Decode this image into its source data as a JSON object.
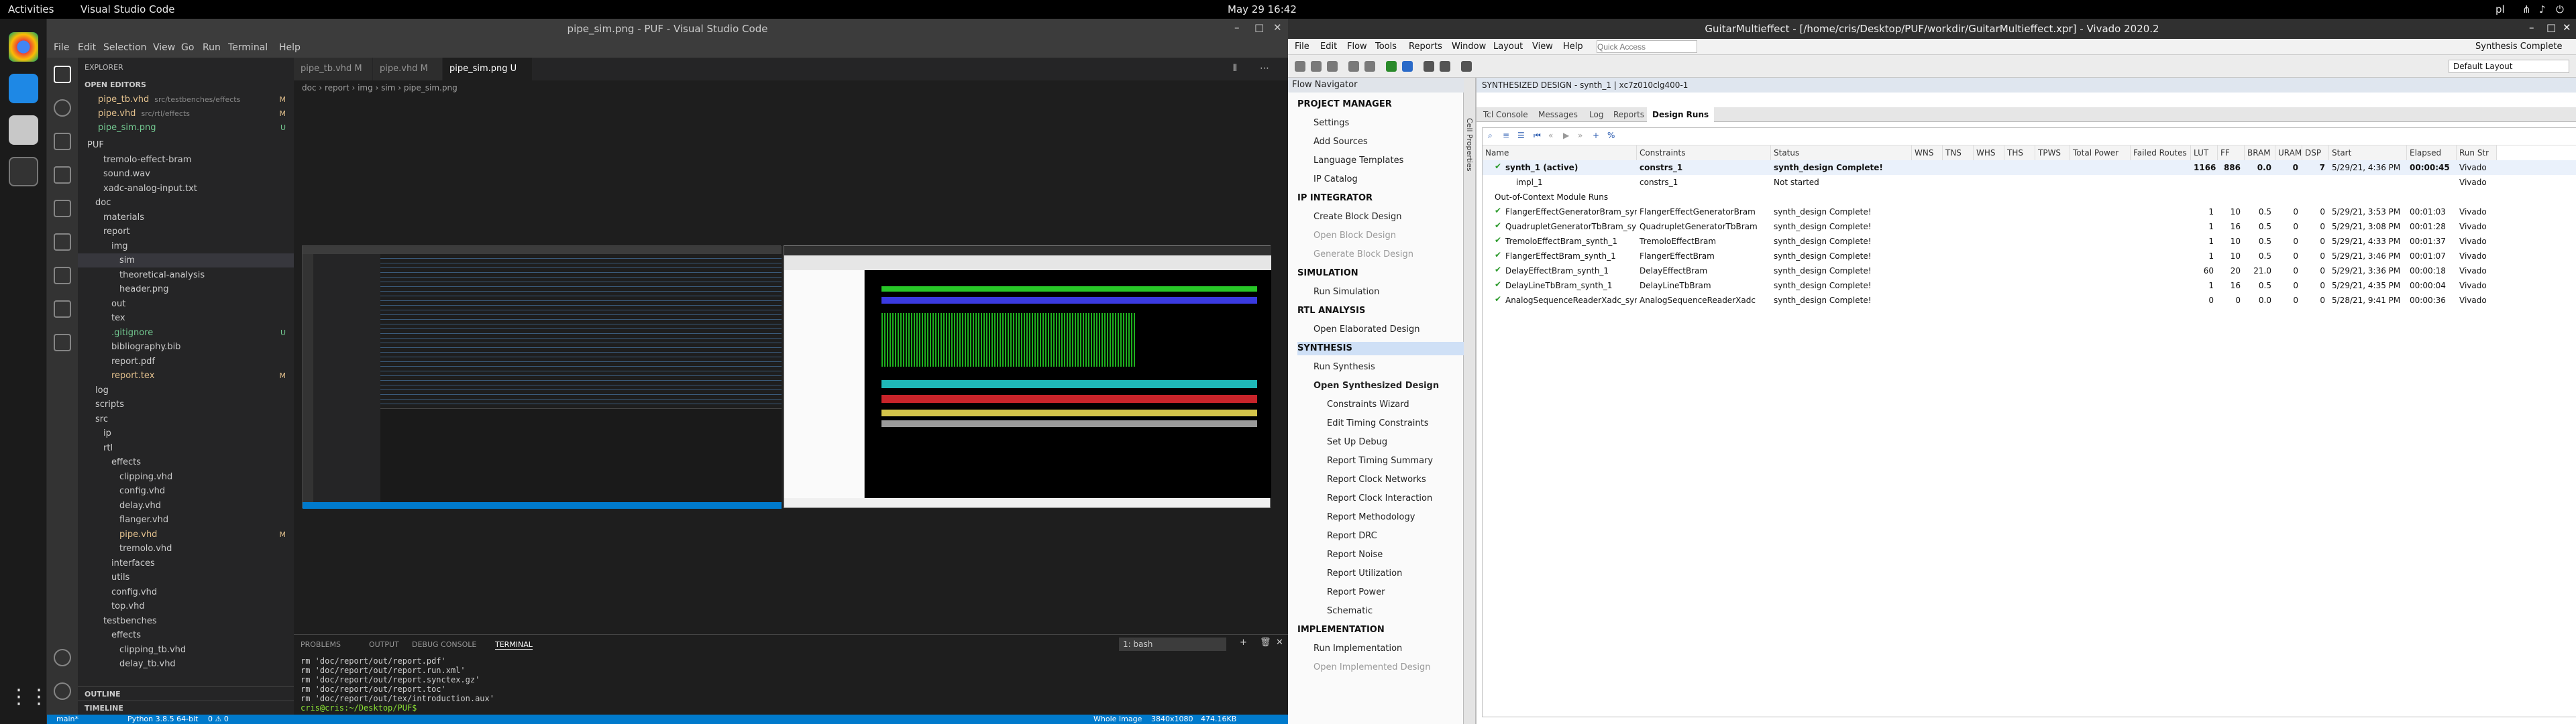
{
  "topbar": {
    "activities": "Activities",
    "app": "Visual Studio Code",
    "clock": "May 29  16:42",
    "lang": "pl"
  },
  "vscode": {
    "title": "pipe_sim.png - PUF - Visual Studio Code",
    "menu": [
      "File",
      "Edit",
      "Selection",
      "View",
      "Go",
      "Run",
      "Terminal",
      "Help"
    ],
    "explorer_title": "EXPLORER",
    "open_editors_label": "OPEN EDITORS",
    "open_editors": [
      {
        "name": "pipe_tb.vhd",
        "path": "src/testbenches/effects",
        "badge": "M"
      },
      {
        "name": "pipe.vhd",
        "path": "src/rtl/effects",
        "badge": "M"
      },
      {
        "name": "pipe_sim.png",
        "path": "",
        "badge": "U"
      }
    ],
    "tree": [
      {
        "label": "PUF",
        "indent": 0,
        "badge": ""
      },
      {
        "label": "tremolo-effect-bram",
        "indent": 2,
        "badge": ""
      },
      {
        "label": "sound.wav",
        "indent": 2,
        "badge": ""
      },
      {
        "label": "xadc-analog-input.txt",
        "indent": 2,
        "badge": ""
      },
      {
        "label": "doc",
        "indent": 1,
        "badge": ""
      },
      {
        "label": "materials",
        "indent": 2,
        "badge": ""
      },
      {
        "label": "report",
        "indent": 2,
        "badge": ""
      },
      {
        "label": "img",
        "indent": 3,
        "badge": ""
      },
      {
        "label": "sim",
        "indent": 4,
        "badge": ""
      },
      {
        "label": "theoretical-analysis",
        "indent": 4,
        "badge": ""
      },
      {
        "label": "header.png",
        "indent": 4,
        "badge": ""
      },
      {
        "label": "out",
        "indent": 3,
        "badge": ""
      },
      {
        "label": "tex",
        "indent": 3,
        "badge": ""
      },
      {
        "label": ".gitignore",
        "indent": 3,
        "badge": "U"
      },
      {
        "label": "bibliography.bib",
        "indent": 3,
        "badge": ""
      },
      {
        "label": "report.pdf",
        "indent": 3,
        "badge": ""
      },
      {
        "label": "report.tex",
        "indent": 3,
        "badge": "M"
      },
      {
        "label": "log",
        "indent": 1,
        "badge": ""
      },
      {
        "label": "scripts",
        "indent": 1,
        "badge": ""
      },
      {
        "label": "src",
        "indent": 1,
        "badge": ""
      },
      {
        "label": "ip",
        "indent": 2,
        "badge": ""
      },
      {
        "label": "rtl",
        "indent": 2,
        "badge": ""
      },
      {
        "label": "effects",
        "indent": 3,
        "badge": ""
      },
      {
        "label": "clipping.vhd",
        "indent": 4,
        "badge": ""
      },
      {
        "label": "config.vhd",
        "indent": 4,
        "badge": ""
      },
      {
        "label": "delay.vhd",
        "indent": 4,
        "badge": ""
      },
      {
        "label": "flanger.vhd",
        "indent": 4,
        "badge": ""
      },
      {
        "label": "pipe.vhd",
        "indent": 4,
        "badge": "M"
      },
      {
        "label": "tremolo.vhd",
        "indent": 4,
        "badge": ""
      },
      {
        "label": "interfaces",
        "indent": 3,
        "badge": ""
      },
      {
        "label": "utils",
        "indent": 3,
        "badge": ""
      },
      {
        "label": "config.vhd",
        "indent": 3,
        "badge": ""
      },
      {
        "label": "top.vhd",
        "indent": 3,
        "badge": ""
      },
      {
        "label": "testbenches",
        "indent": 2,
        "badge": ""
      },
      {
        "label": "effects",
        "indent": 3,
        "badge": ""
      },
      {
        "label": "clipping_tb.vhd",
        "indent": 4,
        "badge": ""
      },
      {
        "label": "delay_tb.vhd",
        "indent": 4,
        "badge": ""
      }
    ],
    "outline_label": "OUTLINE",
    "timeline_label": "TIMELINE",
    "tabs": [
      {
        "label": "pipe_tb.vhd  M"
      },
      {
        "label": "pipe.vhd  M"
      },
      {
        "label": "pipe_sim.png  U"
      }
    ],
    "breadcrumb": "doc › report › img › sim › pipe_sim.png",
    "panel_tabs": [
      "PROBLEMS",
      "OUTPUT",
      "DEBUG CONSOLE",
      "TERMINAL"
    ],
    "terminal_select": "1: bash",
    "terminal_lines": [
      "rm 'doc/report/out/report.pdf'",
      "rm 'doc/report/out/report.run.xml'",
      "rm 'doc/report/out/report.synctex.gz'",
      "rm 'doc/report/out/report.toc'",
      "rm 'doc/report/out/tex/introduction.aux'",
      "cris@cris:~/Desktop/PUF$ "
    ],
    "status": {
      "branch": "main*",
      "python": "Python 3.8.5 64-bit",
      "problems": "0 ⚠ 0",
      "view": "Whole Image",
      "dims": "3840x1080",
      "size": "474.16KB"
    }
  },
  "vivado": {
    "title": "GuitarMultieffect - [/home/cris/Desktop/PUF/workdir/GuitarMultieffect.xpr] - Vivado 2020.2",
    "status": "Synthesis Complete",
    "menu": [
      "File",
      "Edit",
      "Flow",
      "Tools",
      "Reports",
      "Window",
      "Layout",
      "View",
      "Help"
    ],
    "quick_access": "Quick Access",
    "layout_select": "Default Layout",
    "flow_title": "Flow Navigator",
    "flow": [
      {
        "label": "PROJECT MANAGER",
        "type": "h"
      },
      {
        "label": "Settings",
        "type": "i"
      },
      {
        "label": "Add Sources",
        "type": "i"
      },
      {
        "label": "Language Templates",
        "type": "i"
      },
      {
        "label": "IP Catalog",
        "type": "i"
      },
      {
        "label": "IP INTEGRATOR",
        "type": "h"
      },
      {
        "label": "Create Block Design",
        "type": "i"
      },
      {
        "label": "Open Block Design",
        "type": "d"
      },
      {
        "label": "Generate Block Design",
        "type": "d"
      },
      {
        "label": "SIMULATION",
        "type": "h"
      },
      {
        "label": "Run Simulation",
        "type": "i"
      },
      {
        "label": "RTL ANALYSIS",
        "type": "h"
      },
      {
        "label": "Open Elaborated Design",
        "type": "i"
      },
      {
        "label": "SYNTHESIS",
        "type": "hl"
      },
      {
        "label": "Run Synthesis",
        "type": "i"
      },
      {
        "label": "Open Synthesized Design",
        "type": "b"
      },
      {
        "label": "Constraints Wizard",
        "type": "s"
      },
      {
        "label": "Edit Timing Constraints",
        "type": "s"
      },
      {
        "label": "Set Up Debug",
        "type": "s"
      },
      {
        "label": "Report Timing Summary",
        "type": "s"
      },
      {
        "label": "Report Clock Networks",
        "type": "s"
      },
      {
        "label": "Report Clock Interaction",
        "type": "s"
      },
      {
        "label": "Report Methodology",
        "type": "s"
      },
      {
        "label": "Report DRC",
        "type": "s"
      },
      {
        "label": "Report Noise",
        "type": "s"
      },
      {
        "label": "Report Utilization",
        "type": "s"
      },
      {
        "label": "Report Power",
        "type": "s"
      },
      {
        "label": "Schematic",
        "type": "s"
      },
      {
        "label": "IMPLEMENTATION",
        "type": "h"
      },
      {
        "label": "Run Implementation",
        "type": "i"
      },
      {
        "label": "Open Implemented Design",
        "type": "d"
      }
    ],
    "synth_header": "SYNTHESIZED DESIGN - synth_1 | xc7z010clg400-1",
    "side_tab": "Cell Properties",
    "tabs": [
      "Tcl Console",
      "Messages",
      "Log",
      "Reports",
      "Design Runs"
    ],
    "columns": [
      "Name",
      "Constraints",
      "Status",
      "WNS",
      "TNS",
      "WHS",
      "THS",
      "TPWS",
      "Total Power",
      "Failed Routes",
      "LUT",
      "FF",
      "BRAM",
      "URAM",
      "DSP",
      "Start",
      "Elapsed",
      "Run Str"
    ],
    "rows": [
      [
        "synth_1 (active)",
        "constrs_1",
        "synth_design Complete!",
        "",
        "",
        "",
        "",
        "",
        "",
        "",
        "1166",
        "886",
        "0.0",
        "0",
        "7",
        "5/29/21, 4:36 PM",
        "00:00:45",
        "Vivado"
      ],
      [
        "impl_1",
        "constrs_1",
        "Not started",
        "",
        "",
        "",
        "",
        "",
        "",
        "",
        "",
        "",
        "",
        "",
        "",
        "",
        "",
        "Vivado"
      ],
      [
        "Out-of-Context Module Runs",
        "",
        "",
        "",
        "",
        "",
        "",
        "",
        "",
        "",
        "",
        "",
        "",
        "",
        "",
        "",
        "",
        ""
      ],
      [
        "FlangerEffectGeneratorBram_synth_1",
        "FlangerEffectGeneratorBram",
        "synth_design Complete!",
        "",
        "",
        "",
        "",
        "",
        "",
        "",
        "1",
        "10",
        "0.5",
        "0",
        "0",
        "5/29/21, 3:53 PM",
        "00:01:03",
        "Vivado"
      ],
      [
        "QuadrupletGeneratorTbBram_synth_1",
        "QuadrupletGeneratorTbBram",
        "synth_design Complete!",
        "",
        "",
        "",
        "",
        "",
        "",
        "",
        "1",
        "16",
        "0.5",
        "0",
        "0",
        "5/29/21, 3:08 PM",
        "00:01:28",
        "Vivado"
      ],
      [
        "TremoloEffectBram_synth_1",
        "TremoloEffectBram",
        "synth_design Complete!",
        "",
        "",
        "",
        "",
        "",
        "",
        "",
        "1",
        "10",
        "0.5",
        "0",
        "0",
        "5/29/21, 4:33 PM",
        "00:01:37",
        "Vivado"
      ],
      [
        "FlangerEffectBram_synth_1",
        "FlangerEffectBram",
        "synth_design Complete!",
        "",
        "",
        "",
        "",
        "",
        "",
        "",
        "1",
        "10",
        "0.5",
        "0",
        "0",
        "5/29/21, 3:46 PM",
        "00:01:07",
        "Vivado"
      ],
      [
        "DelayEffectBram_synth_1",
        "DelayEffectBram",
        "synth_design Complete!",
        "",
        "",
        "",
        "",
        "",
        "",
        "",
        "60",
        "20",
        "21.0",
        "0",
        "0",
        "5/29/21, 3:36 PM",
        "00:00:18",
        "Vivado"
      ],
      [
        "DelayLineTbBram_synth_1",
        "DelayLineTbBram",
        "synth_design Complete!",
        "",
        "",
        "",
        "",
        "",
        "",
        "",
        "1",
        "16",
        "0.5",
        "0",
        "0",
        "5/29/21, 4:35 PM",
        "00:00:04",
        "Vivado"
      ],
      [
        "AnalogSequenceReaderXadc_synth_1",
        "AnalogSequenceReaderXadc",
        "synth_design Complete!",
        "",
        "",
        "",
        "",
        "",
        "",
        "",
        "0",
        "0",
        "0.0",
        "0",
        "0",
        "5/28/21, 9:41 PM",
        "00:00:36",
        "Vivado"
      ]
    ]
  }
}
